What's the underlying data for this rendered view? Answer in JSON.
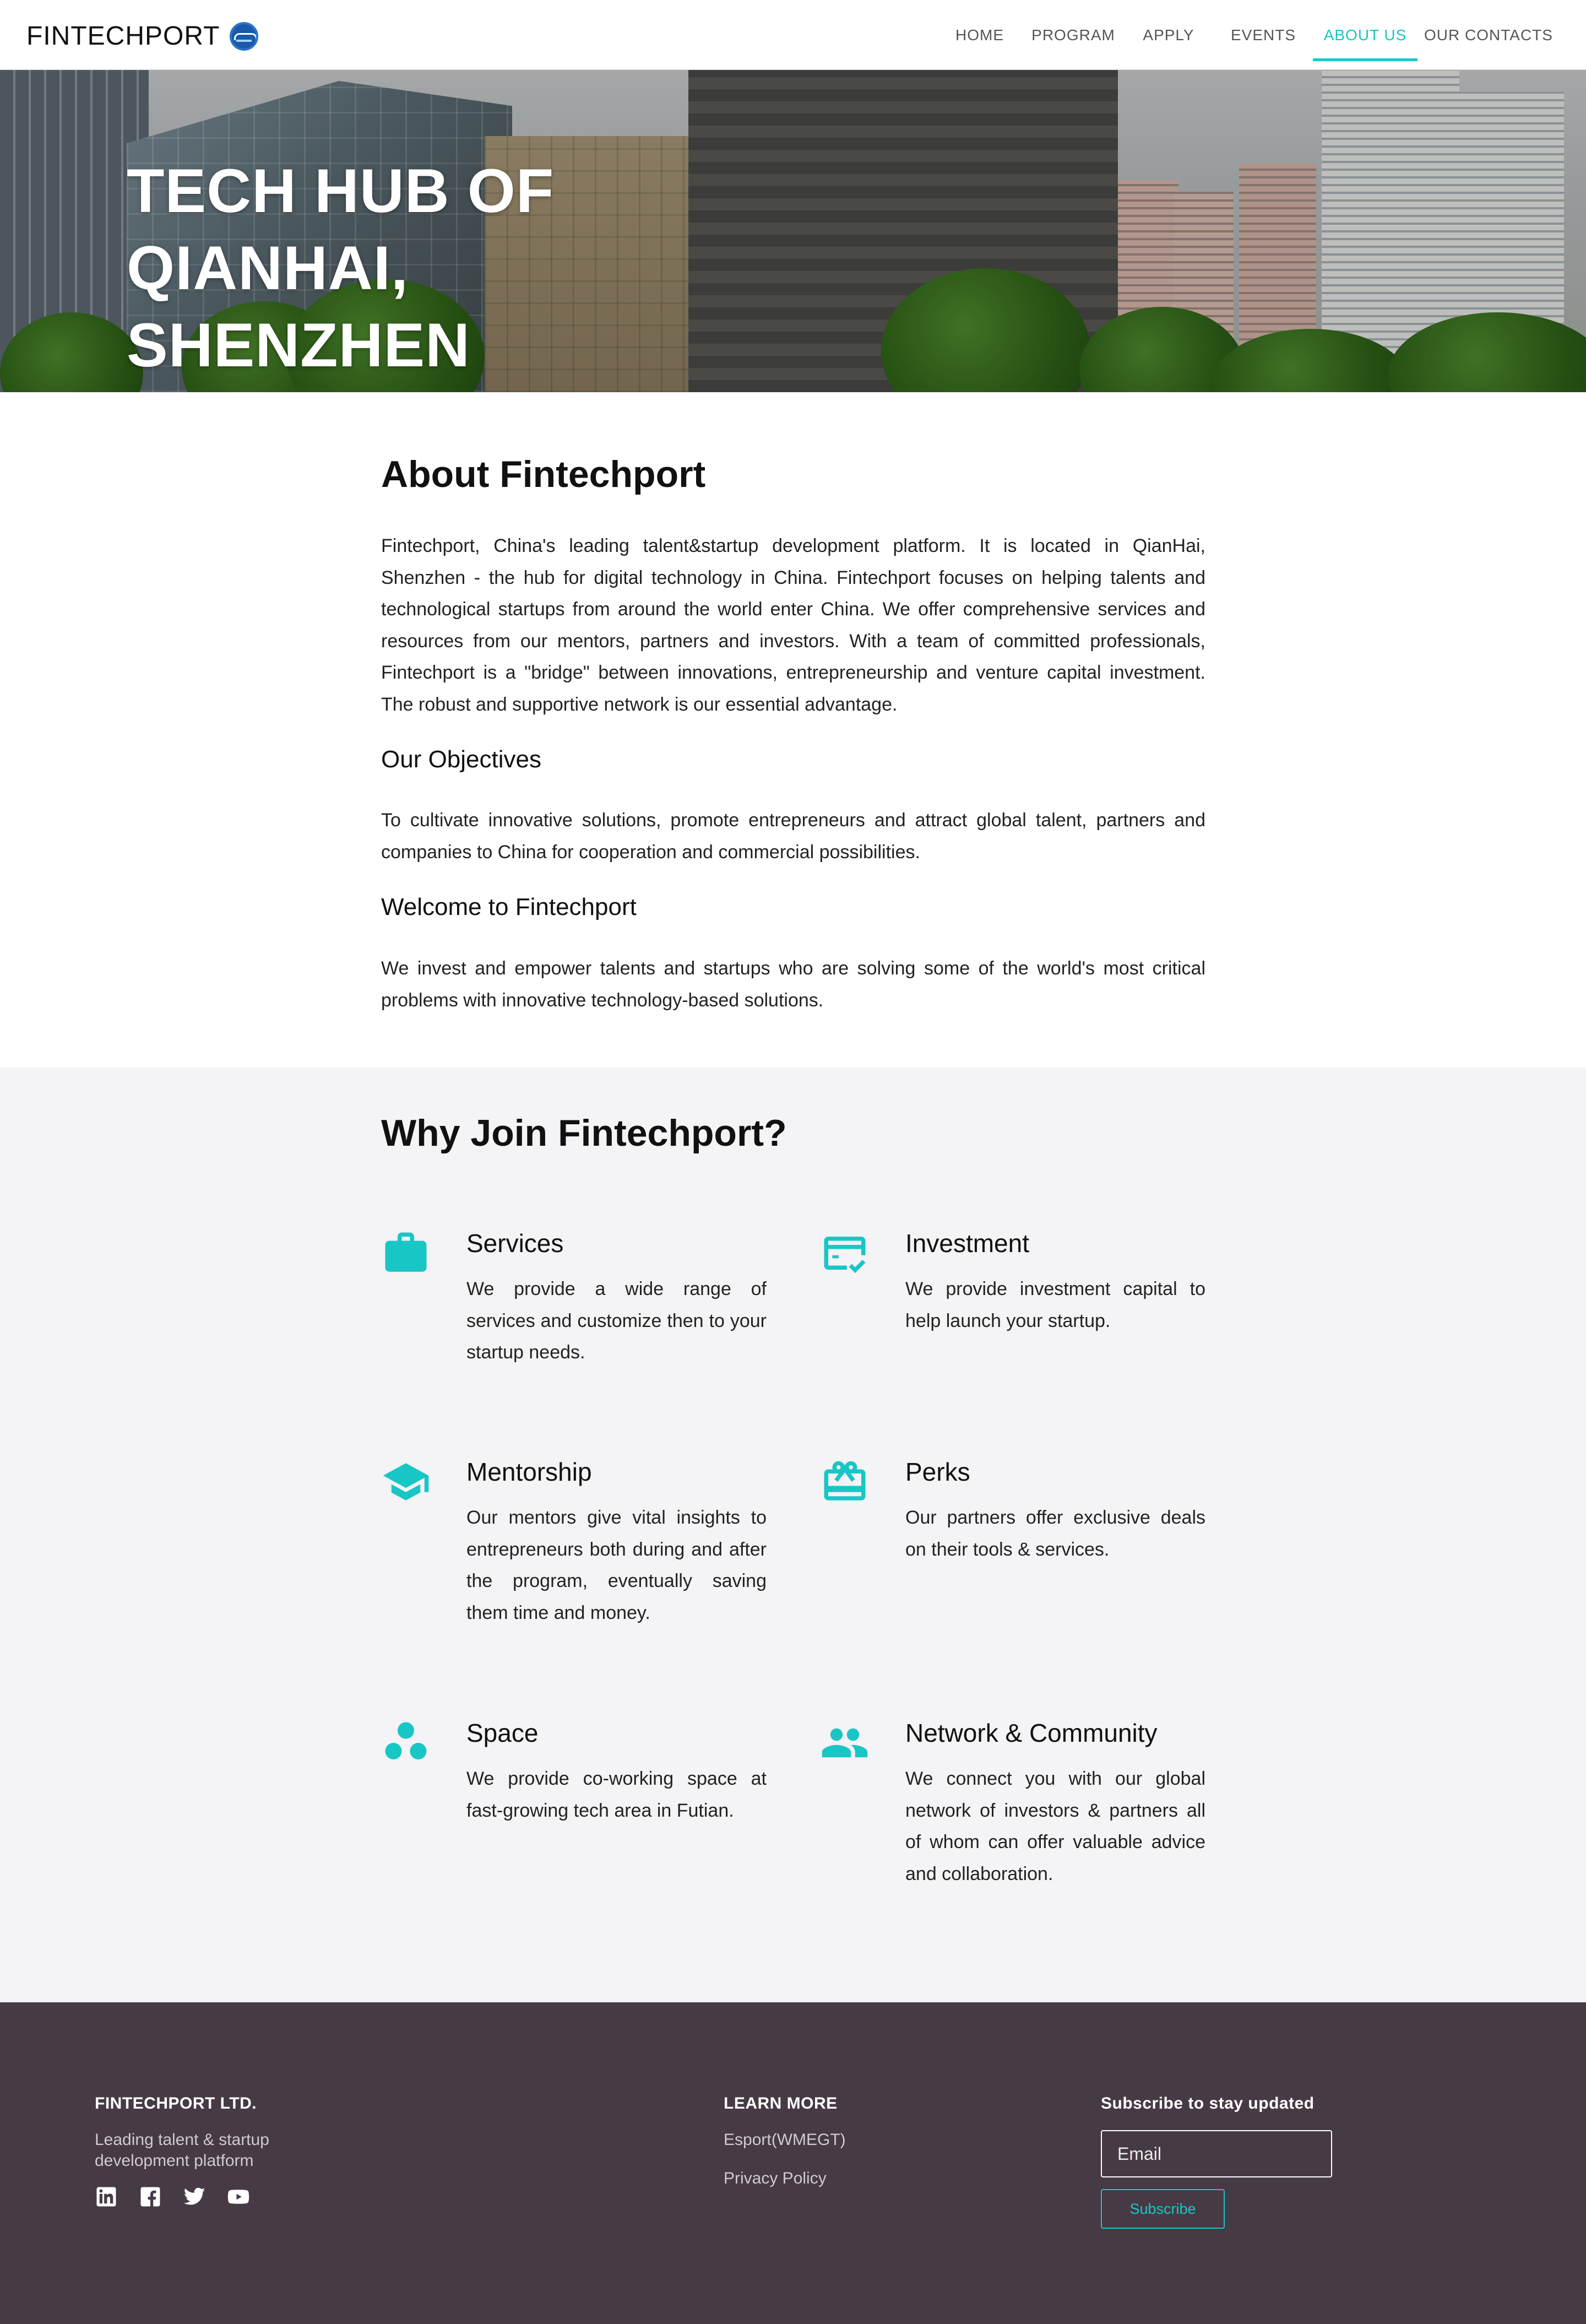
{
  "brand": {
    "name": "FINTECHPORT",
    "accent": "#19c6c6",
    "footer_bg": "#463a44"
  },
  "nav": [
    {
      "label": "HOME",
      "active": false
    },
    {
      "label": "PROGRAM",
      "active": false
    },
    {
      "label": "APPLY",
      "active": false
    },
    {
      "label": "EVENTS",
      "active": false
    },
    {
      "label": "ABOUT US",
      "active": true
    },
    {
      "label": "OUR CONTACTS",
      "active": false
    }
  ],
  "hero": {
    "title_line1": "TECH HUB OF QIANHAI,",
    "title_line2": "SHENZHEN"
  },
  "about": {
    "title": "About Fintechport",
    "intro": "Fintechport, China's leading talent&startup development platform. It is located in QianHai, Shenzhen - the hub for digital technology in China. Fintechport focuses on helping talents and technological startups from around the world enter China. We offer comprehensive services and resources from our mentors, partners and investors. With a team of committed professionals, Fintechport is a \"bridge\" between innovations, entrepreneurship and venture capital investment. The robust and supportive network is our essential advantage.",
    "objectives_title": "Our Objectives",
    "objectives_text": "To cultivate innovative solutions, promote entrepreneurs and attract global talent, partners and companies to China for cooperation and commercial possibilities.",
    "welcome_title": "Welcome to Fintechport",
    "welcome_text": "We invest and empower talents and startups who are solving some of the world's most critical problems with innovative technology-based solutions."
  },
  "why": {
    "title": "Why Join Fintechport?",
    "features": [
      {
        "icon": "briefcase-icon",
        "title": "Services",
        "text": "We provide a wide range of services and customize then to your startup needs."
      },
      {
        "icon": "credit-card-check-icon",
        "title": "Investment",
        "text": "We provide investment capital to help launch your startup."
      },
      {
        "icon": "graduation-cap-icon",
        "title": "Mentorship",
        "text": "Our mentors give vital insights to entrepreneurs both during and after the program, eventually saving them time and money."
      },
      {
        "icon": "gift-card-icon",
        "title": "Perks",
        "text": "Our partners offer exclusive deals on their tools & services."
      },
      {
        "icon": "workspaces-icon",
        "title": "Space",
        "text": "We provide co-working space at fast-growing tech area in Futian."
      },
      {
        "icon": "people-icon",
        "title": "Network & Community",
        "text": "We connect you with our global network of investors & partners all of whom can offer valuable advice and collaboration."
      }
    ]
  },
  "footer": {
    "company": "FINTECHPORT LTD.",
    "tagline_line1": "Leading talent & startup",
    "tagline_line2": "development platform",
    "social": [
      "linkedin-icon",
      "facebook-icon",
      "twitter-icon",
      "youtube-icon"
    ],
    "learn_more_title": "LEARN MORE",
    "links": [
      "Esport(WMEGT)",
      "Privacy Policy"
    ],
    "subscribe_title": "Subscribe to stay updated",
    "email_placeholder": "Email",
    "subscribe_label": "Subscribe"
  }
}
